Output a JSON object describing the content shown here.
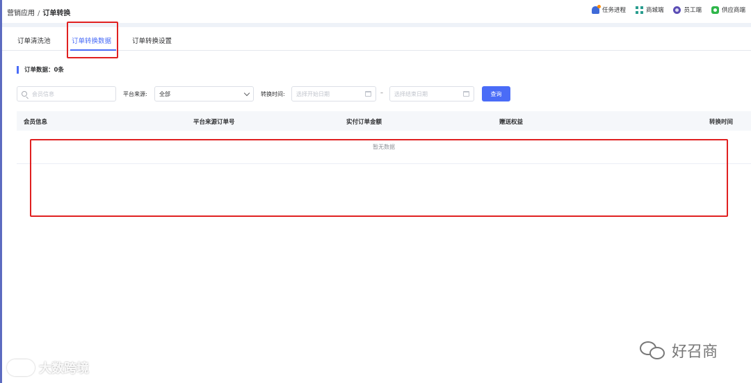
{
  "breadcrumb": {
    "parent": "营销应用",
    "separator": "/",
    "current": "订单转换"
  },
  "header_tools": [
    {
      "label": "任务进程",
      "icon": "bell-icon"
    },
    {
      "label": "商城端",
      "icon": "qrcode-icon"
    },
    {
      "label": "员工端",
      "icon": "staff-icon"
    },
    {
      "label": "供应商端",
      "icon": "supplier-icon"
    }
  ],
  "tabs": [
    {
      "label": "订单清洗池",
      "active": false
    },
    {
      "label": "订单转换数据",
      "active": true
    },
    {
      "label": "订单转换设置",
      "active": false
    }
  ],
  "summary": {
    "label": "订单数据：0条"
  },
  "filters": {
    "member_placeholder": "会员信息",
    "platform_label": "平台来源:",
    "platform_value": "全部",
    "time_label": "转换时间:",
    "start_placeholder": "选择开始日期",
    "range_separator": "–",
    "end_placeholder": "选择结束日期",
    "search_button": "查询"
  },
  "table": {
    "columns": [
      "会员信息",
      "平台来源订单号",
      "实付订单金额",
      "赠送权益",
      "转换时间"
    ],
    "rows": [],
    "empty_text": "暂无数据"
  },
  "watermarks": {
    "left": "大数跨境",
    "right": "好召商"
  },
  "colors": {
    "primary": "#4a6cf7",
    "highlight": "#e02020"
  }
}
